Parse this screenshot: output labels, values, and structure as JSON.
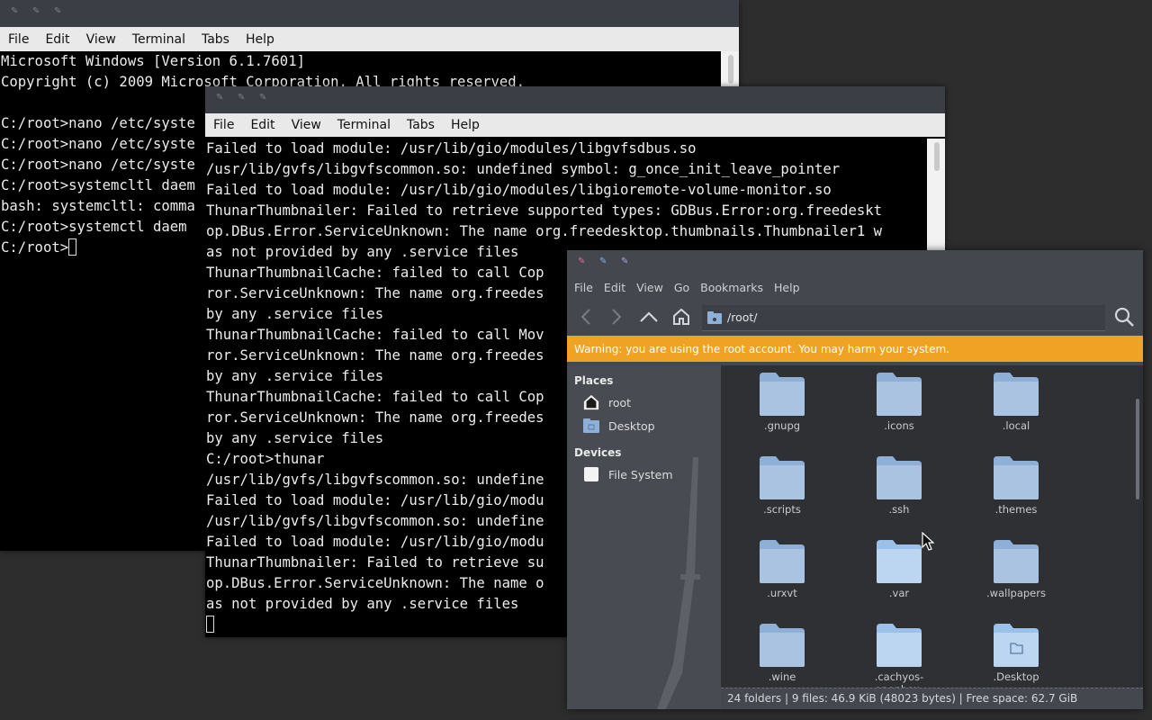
{
  "terminal1": {
    "menu": [
      "File",
      "Edit",
      "View",
      "Terminal",
      "Tabs",
      "Help"
    ],
    "lines": [
      "Microsoft Windows [Version 6.1.7601]",
      "Copyright (c) 2009 Microsoft Corporation. All rights reserved.",
      "",
      "C:/root>nano /etc/syste",
      "C:/root>nano /etc/syste",
      "C:/root>nano /etc/syste",
      "C:/root>systemcltl daem",
      "bash: systemcltl: comma",
      "C:/root>systemctl daem",
      "C:/root>"
    ]
  },
  "terminal2": {
    "menu": [
      "File",
      "Edit",
      "View",
      "Terminal",
      "Tabs",
      "Help"
    ],
    "lines": [
      "Failed to load module: /usr/lib/gio/modules/libgvfsdbus.so",
      "/usr/lib/gvfs/libgvfscommon.so: undefined symbol: g_once_init_leave_pointer",
      "Failed to load module: /usr/lib/gio/modules/libgioremote-volume-monitor.so",
      "ThunarThumbnailer: Failed to retrieve supported types: GDBus.Error:org.freedeskt",
      "op.DBus.Error.ServiceUnknown: The name org.freedesktop.thumbnails.Thumbnailer1 w",
      "as not provided by any .service files",
      "ThunarThumbnailCache: failed to call Cop",
      "ror.ServiceUnknown: The name org.freedes",
      "by any .service files",
      "ThunarThumbnailCache: failed to call Mov",
      "ror.ServiceUnknown: The name org.freedes",
      "by any .service files",
      "ThunarThumbnailCache: failed to call Cop",
      "ror.ServiceUnknown: The name org.freedes",
      "by any .service files",
      "C:/root>thunar",
      "/usr/lib/gvfs/libgvfscommon.so: undefine",
      "Failed to load module: /usr/lib/gio/modu",
      "/usr/lib/gvfs/libgvfscommon.so: undefine",
      "Failed to load module: /usr/lib/gio/modu",
      "ThunarThumbnailer: Failed to retrieve su",
      "op.DBus.Error.ServiceUnknown: The name o",
      "as not provided by any .service files"
    ]
  },
  "thunar": {
    "menu": [
      "File",
      "Edit",
      "View",
      "Go",
      "Bookmarks",
      "Help"
    ],
    "location": "/root/",
    "warning": "Warning: you are using the root account. You may harm your system.",
    "places_header": "Places",
    "devices_header": "Devices",
    "places": [
      "root",
      "Desktop"
    ],
    "devices": [
      "File System"
    ],
    "folders": [
      ".gnupg",
      ".icons",
      ".local",
      ".scripts",
      ".ssh",
      ".themes",
      ".urxvt",
      ".var",
      ".wallpapers",
      ".wine",
      ".cachyos-openbox-",
      ".Desktop"
    ],
    "status": "24 folders  |  9 files: 46.9 KiB (48023 bytes)  |  Free space: 62.7 GiB",
    "colors": {
      "warning": "#efa224",
      "folder": "#a9c3e0",
      "folder_tab": "#8fb0d6"
    }
  }
}
